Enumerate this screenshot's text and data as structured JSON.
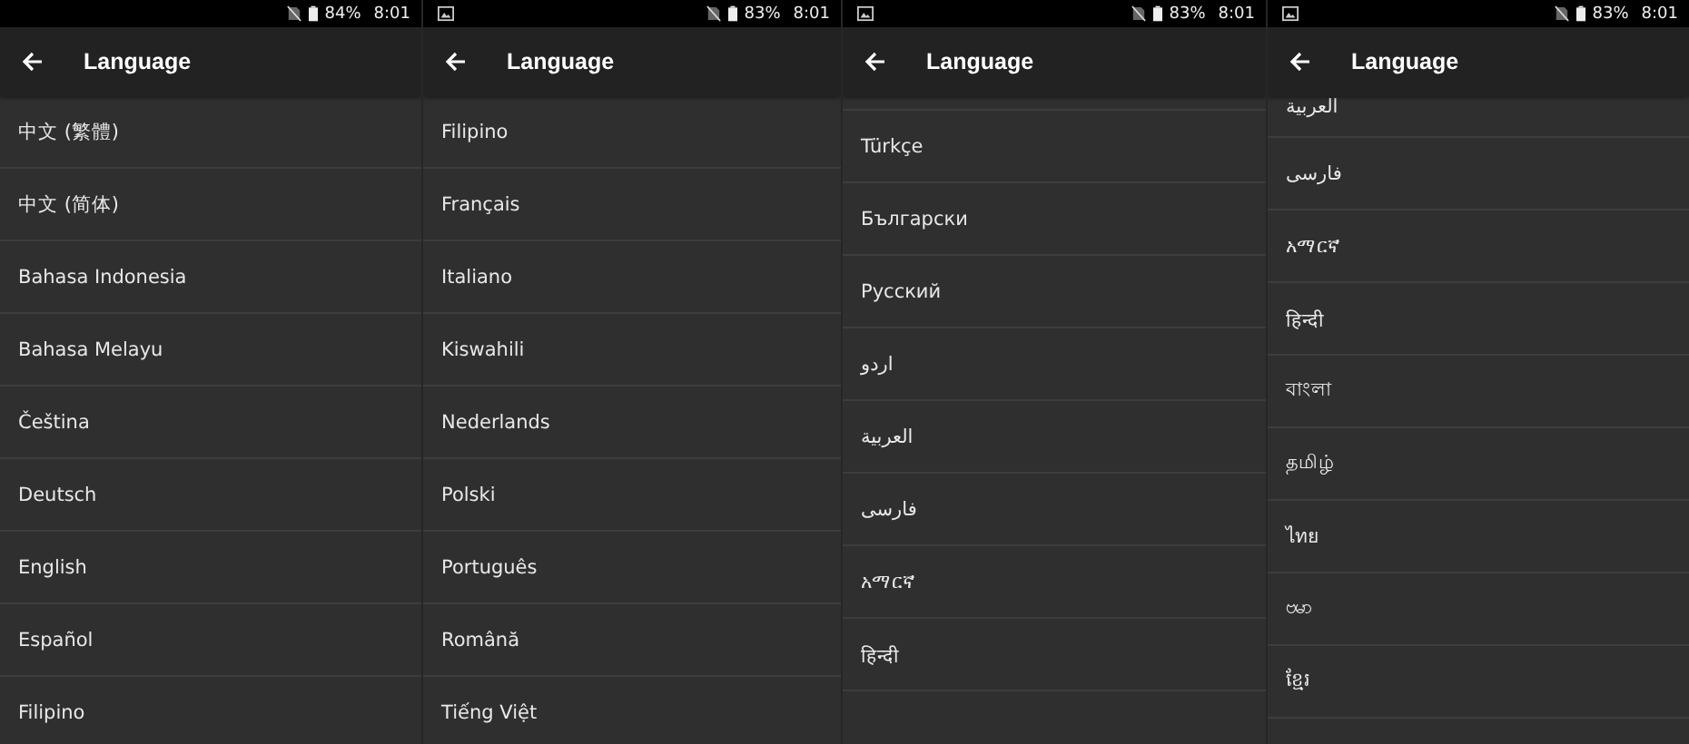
{
  "screens": [
    {
      "status_bar": {
        "image_notification": false,
        "battery": "84%",
        "time": "8:01"
      },
      "title": "Language",
      "items": [
        "中文 (繁體)",
        "中文 (简体)",
        "Bahasa Indonesia",
        "Bahasa Melayu",
        "Čeština",
        "Deutsch",
        "English",
        "Español",
        "Filipino"
      ]
    },
    {
      "status_bar": {
        "image_notification": true,
        "battery": "83%",
        "time": "8:01"
      },
      "title": "Language",
      "items": [
        "Filipino",
        "Français",
        "Italiano",
        "Kiswahili",
        "Nederlands",
        "Polski",
        "Português",
        "Română",
        "Tiếng Việt"
      ]
    },
    {
      "status_bar": {
        "image_notification": true,
        "battery": "83%",
        "time": "8:01"
      },
      "title": "Language",
      "items": [
        "Türkçe",
        "Български",
        "Русский",
        "اردو",
        "العربية",
        "فارسی",
        "አማርኛ",
        "हिन्दी"
      ]
    },
    {
      "status_bar": {
        "image_notification": true,
        "battery": "83%",
        "time": "8:01"
      },
      "title": "Language",
      "items": [
        "العربية",
        "فارسی",
        "አማርኛ",
        "हिन्दी",
        "বাংলা",
        "தமிழ்",
        "ไทย",
        "ဗမာ",
        "ខ្មែរ"
      ]
    }
  ]
}
